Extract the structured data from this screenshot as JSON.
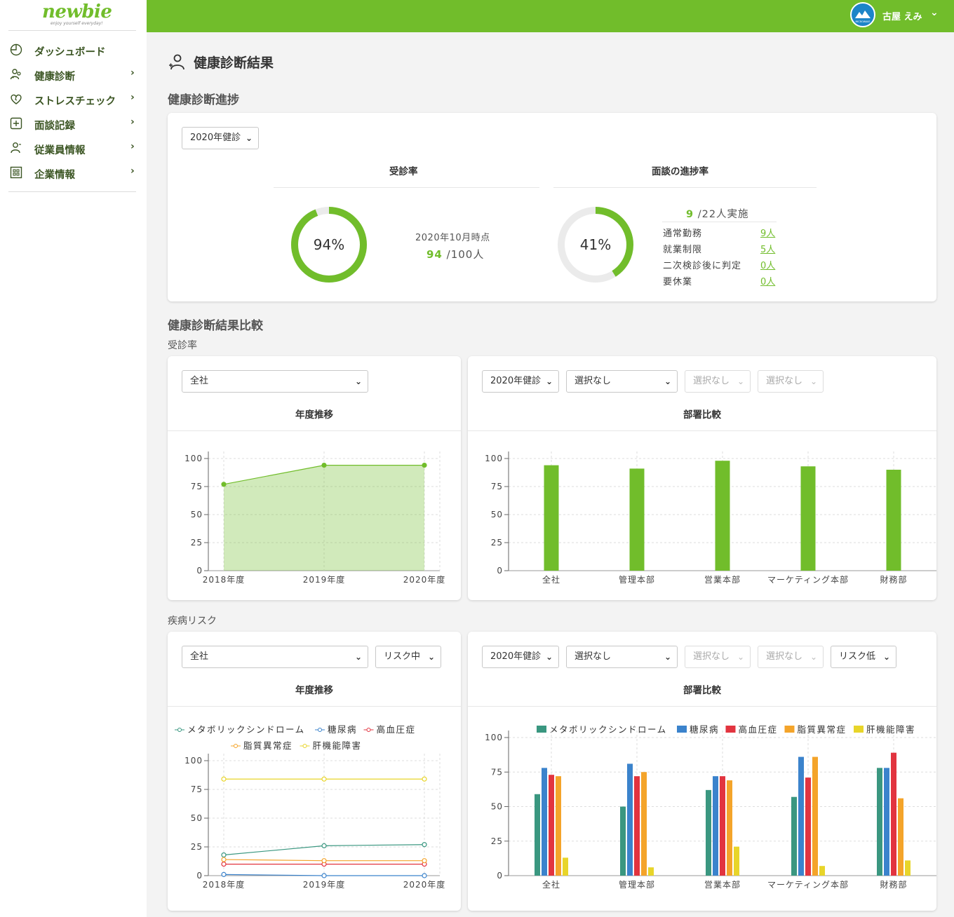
{
  "brand": {
    "name": "newbie",
    "tagline": "enjoy yourself everyday!"
  },
  "sidebar": {
    "items": [
      {
        "label": "ダッシュボード",
        "icon": "pie-chart-icon",
        "chevron": ""
      },
      {
        "label": "健康診断",
        "icon": "people-icon",
        "chevron": "›"
      },
      {
        "label": "ストレスチェック",
        "icon": "heart-icon",
        "chevron": "›"
      },
      {
        "label": "面談記録",
        "icon": "plus-square-icon",
        "chevron": "›"
      },
      {
        "label": "従業員情報",
        "icon": "person-icon",
        "chevron": "›"
      },
      {
        "label": "企業情報",
        "icon": "grid-icon",
        "chevron": "›"
      }
    ]
  },
  "header": {
    "user_name": "古屋 えみ",
    "avatar_brand": "MICROWAVE",
    "dropdown": "⌄"
  },
  "page": {
    "title": "健康診断結果"
  },
  "progress": {
    "section_title": "健康診断進捗",
    "year_select": "2020年健診",
    "exam_rate": {
      "heading": "受診率",
      "percent_label": "94%",
      "value": 94,
      "as_of": "2020年10月時点",
      "count": "94",
      "total": "/100人"
    },
    "interview": {
      "heading": "面談の進捗率",
      "percent_label": "41%",
      "value": 41,
      "done": "9",
      "total": "/22人実施",
      "rows": [
        {
          "label": "通常勤務",
          "value": "9人"
        },
        {
          "label": "就業制限",
          "value": "5人"
        },
        {
          "label": "二次検診後に判定",
          "value": "0人"
        },
        {
          "label": "要休業",
          "value": "0人"
        }
      ]
    }
  },
  "comparison": {
    "section_title": "健康診断結果比較",
    "exam": {
      "sub_title": "受診率",
      "trend": {
        "select": "全社",
        "heading": "年度推移"
      },
      "dept": {
        "selects": [
          "2020年健診",
          "選択なし",
          "選択なし",
          "選択なし"
        ],
        "heading": "部署比較"
      }
    },
    "risk": {
      "sub_title": "疾病リスク",
      "trend": {
        "selects": [
          "全社",
          "リスク中"
        ],
        "heading": "年度推移"
      },
      "dept": {
        "selects": [
          "2020年健診",
          "選択なし",
          "選択なし",
          "選択なし",
          "リスク低"
        ],
        "heading": "部署比較"
      }
    }
  },
  "colors": {
    "brand_green": "#71bd2b",
    "metabolic": "#3a9780",
    "diabetes": "#3b83cc",
    "hypertension": "#e2343f",
    "lipid": "#f4a42a",
    "liver": "#e8d52a"
  },
  "chart_data": [
    {
      "type": "area",
      "name": "受診率 年度推移",
      "categories": [
        "2018年度",
        "2019年度",
        "2020年度"
      ],
      "values": [
        77,
        94,
        94
      ],
      "ylim": [
        0,
        100
      ],
      "yticks": [
        0,
        25,
        50,
        75,
        100
      ],
      "grid": true
    },
    {
      "type": "bar",
      "name": "受診率 部署比較",
      "categories": [
        "全社",
        "管理本部",
        "営業本部",
        "マーケティング本部",
        "財務部"
      ],
      "values": [
        94,
        91,
        98,
        93,
        90
      ],
      "ylim": [
        0,
        100
      ],
      "yticks": [
        0,
        25,
        50,
        75,
        100
      ],
      "grid": true
    },
    {
      "type": "line",
      "name": "疾病リスク 年度推移",
      "categories": [
        "2018年度",
        "2019年度",
        "2020年度"
      ],
      "ylim": [
        0,
        100
      ],
      "yticks": [
        0,
        25,
        50,
        75,
        100
      ],
      "grid": true,
      "legend": "top",
      "series": [
        {
          "name": "メタボリックシンドローム",
          "values": [
            18,
            26,
            27
          ]
        },
        {
          "name": "糖尿病",
          "values": [
            1,
            0,
            0
          ]
        },
        {
          "name": "高血圧症",
          "values": [
            10,
            10,
            10
          ]
        },
        {
          "name": "脂質異常症",
          "values": [
            14,
            13,
            13
          ]
        },
        {
          "name": "肝機能障害",
          "values": [
            84,
            84,
            84
          ]
        }
      ]
    },
    {
      "type": "bar",
      "name": "疾病リスク 部署比較",
      "categories": [
        "全社",
        "管理本部",
        "営業本部",
        "マーケティング本部",
        "財務部"
      ],
      "ylim": [
        0,
        100
      ],
      "yticks": [
        0,
        25,
        50,
        75,
        100
      ],
      "grid": true,
      "legend": "top",
      "series": [
        {
          "name": "メタボリックシンドローム",
          "values": [
            59,
            50,
            62,
            57,
            78
          ]
        },
        {
          "name": "糖尿病",
          "values": [
            78,
            81,
            72,
            86,
            78
          ]
        },
        {
          "name": "高血圧症",
          "values": [
            73,
            72,
            72,
            71,
            89
          ]
        },
        {
          "name": "脂質異常症",
          "values": [
            72,
            75,
            69,
            86,
            56
          ]
        },
        {
          "name": "肝機能障害",
          "values": [
            13,
            6,
            21,
            7,
            11
          ]
        }
      ]
    }
  ]
}
